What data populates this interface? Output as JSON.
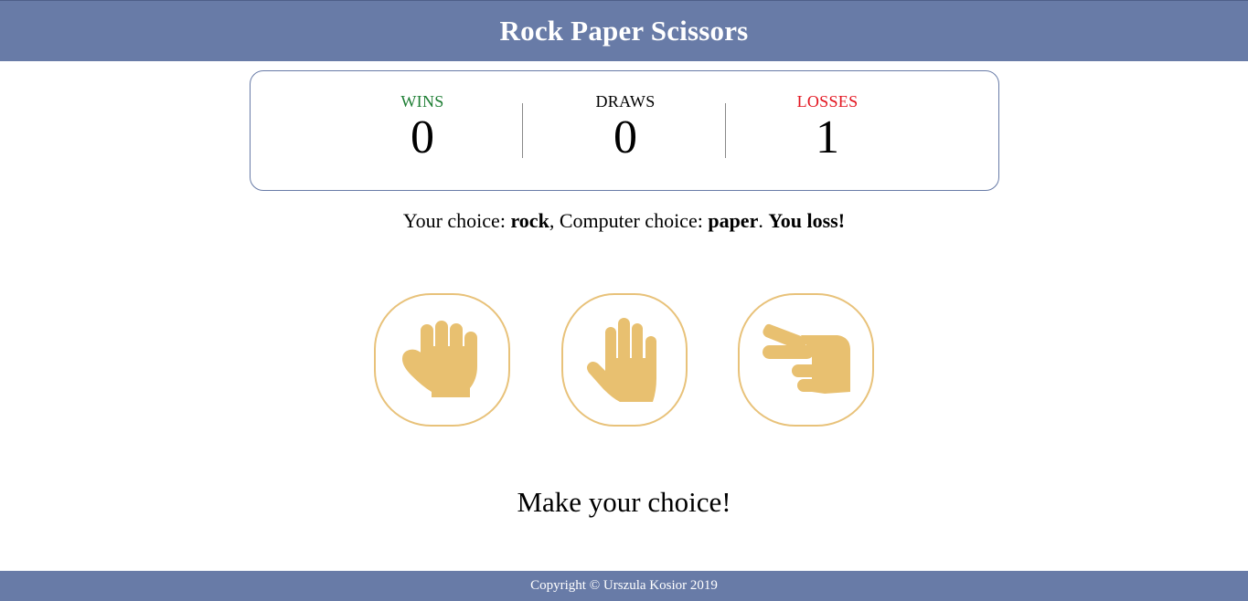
{
  "header": {
    "title": "Rock Paper Scissors"
  },
  "scoreboard": {
    "wins": {
      "label": "WINS",
      "value": "0"
    },
    "draws": {
      "label": "DRAWS",
      "value": "0"
    },
    "losses": {
      "label": "LOSSES",
      "value": "1"
    }
  },
  "result": {
    "your_choice_label": "Your choice: ",
    "your_choice": "rock",
    "computer_choice_label": ", Computer choice: ",
    "computer_choice": "paper",
    "period": ". ",
    "outcome": "You loss!"
  },
  "choices": [
    {
      "name": "rock",
      "icon": "fist-hand-icon"
    },
    {
      "name": "paper",
      "icon": "open-hand-icon"
    },
    {
      "name": "scissors",
      "icon": "scissors-hand-icon"
    }
  ],
  "prompt": "Make your choice!",
  "footer": {
    "copyright": "Copyright © Urszula Kosior 2019"
  },
  "colors": {
    "header_bg": "#687ba7",
    "accent_hand": "#e8c070",
    "wins": "#1e7e34",
    "losses": "#e3141f"
  }
}
